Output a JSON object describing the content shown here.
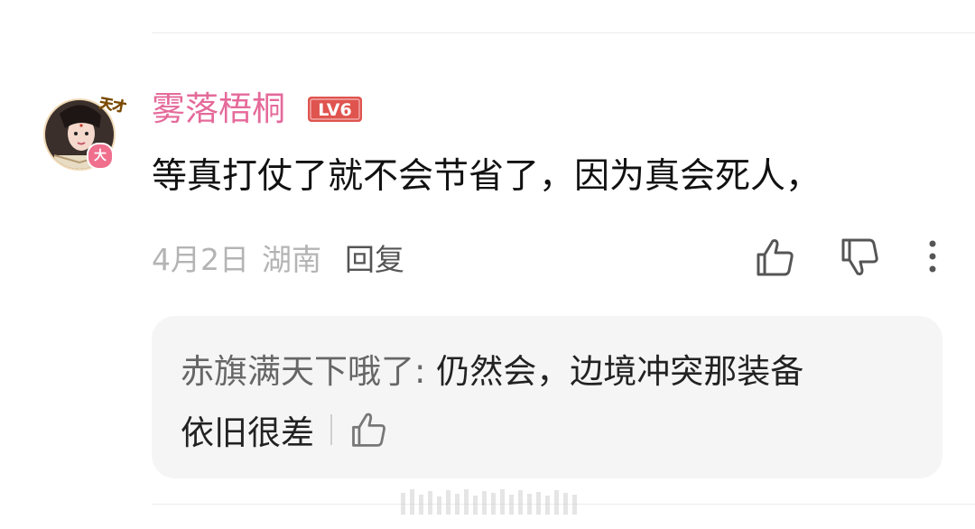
{
  "comment": {
    "username": "雾落梧桐",
    "level": "LV6",
    "avatar_badges": {
      "corner": "天才",
      "circle": "大"
    },
    "text": "等真打仗了就不会节省了，因为真会死人，",
    "date": "4月2日",
    "location": "湖南",
    "reply_label": "回复",
    "icons": {
      "like": "thumbs-up-icon",
      "dislike": "thumbs-down-icon",
      "more": "more-vertical-icon"
    }
  },
  "sub_reply": {
    "author": "赤旗满天下哦了:",
    "text_line1": " 仍然会，边境冲突那装备",
    "text_line2": "依旧很差",
    "like_icon": "thumbs-up-icon"
  },
  "colors": {
    "username": "#e56a9a",
    "level_badge": "#e0544f",
    "meta_text": "#b4b4b4",
    "reply_background": "#f5f5f5"
  }
}
